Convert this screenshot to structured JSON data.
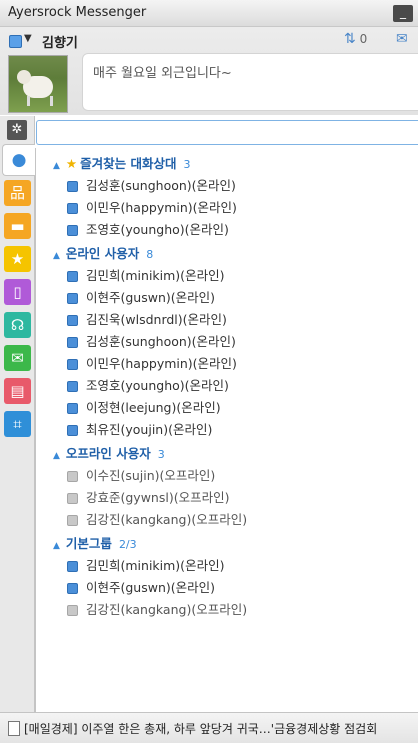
{
  "window": {
    "title": "Ayersrock Messenger"
  },
  "user": {
    "name": "김향기",
    "status_message": "매주 월요일 외근입니다~",
    "transfer_count": "0"
  },
  "sidebar": {
    "icons": [
      "gear-icon",
      "contacts-icon",
      "org-chart-icon",
      "chat-icon",
      "favorites-icon",
      "tablet-icon",
      "support-icon",
      "mail-icon",
      "document-icon",
      "crop-icon"
    ],
    "colors": {
      "org": "#f5a623",
      "chat": "#f5a623",
      "star": "#f5c400",
      "tablet": "#b05ad8",
      "support": "#2eb8a0",
      "mail": "#3cb84a",
      "doc": "#e85a6a",
      "crop": "#2f8fd8"
    }
  },
  "groups": {
    "favorites": {
      "label": "즐겨찾는 대화상대",
      "count": "3",
      "items": [
        "김성훈(sunghoon)(온라인)",
        "이민우(happymin)(온라인)",
        "조영호(youngho)(온라인)"
      ]
    },
    "online": {
      "label": "온라인 사용자",
      "count": "8",
      "items": [
        "김민희(minikim)(온라인)",
        "이현주(guswn)(온라인)",
        "김진욱(wlsdnrdl)(온라인)",
        "김성훈(sunghoon)(온라인)",
        "이민우(happymin)(온라인)",
        "조영호(youngho)(온라인)",
        "이정현(leejung)(온라인)",
        "최유진(youjin)(온라인)"
      ]
    },
    "offline": {
      "label": "오프라인 사용자",
      "count": "3",
      "items": [
        "이수진(sujin)(오프라인)",
        "강효준(gywnsl)(오프라인)",
        "김강진(kangkang)(오프라인)"
      ]
    },
    "basic": {
      "label": "기본그룹",
      "count": "2/3",
      "items": [
        "김민희(minikim)(온라인)",
        "이현주(guswn)(온라인)",
        "김강진(kangkang)(오프라인)"
      ]
    }
  },
  "footer": {
    "news": "[매일경제] 이주열 한은 총재, 하루 앞당겨 귀국…'금융경제상황 점검회"
  }
}
